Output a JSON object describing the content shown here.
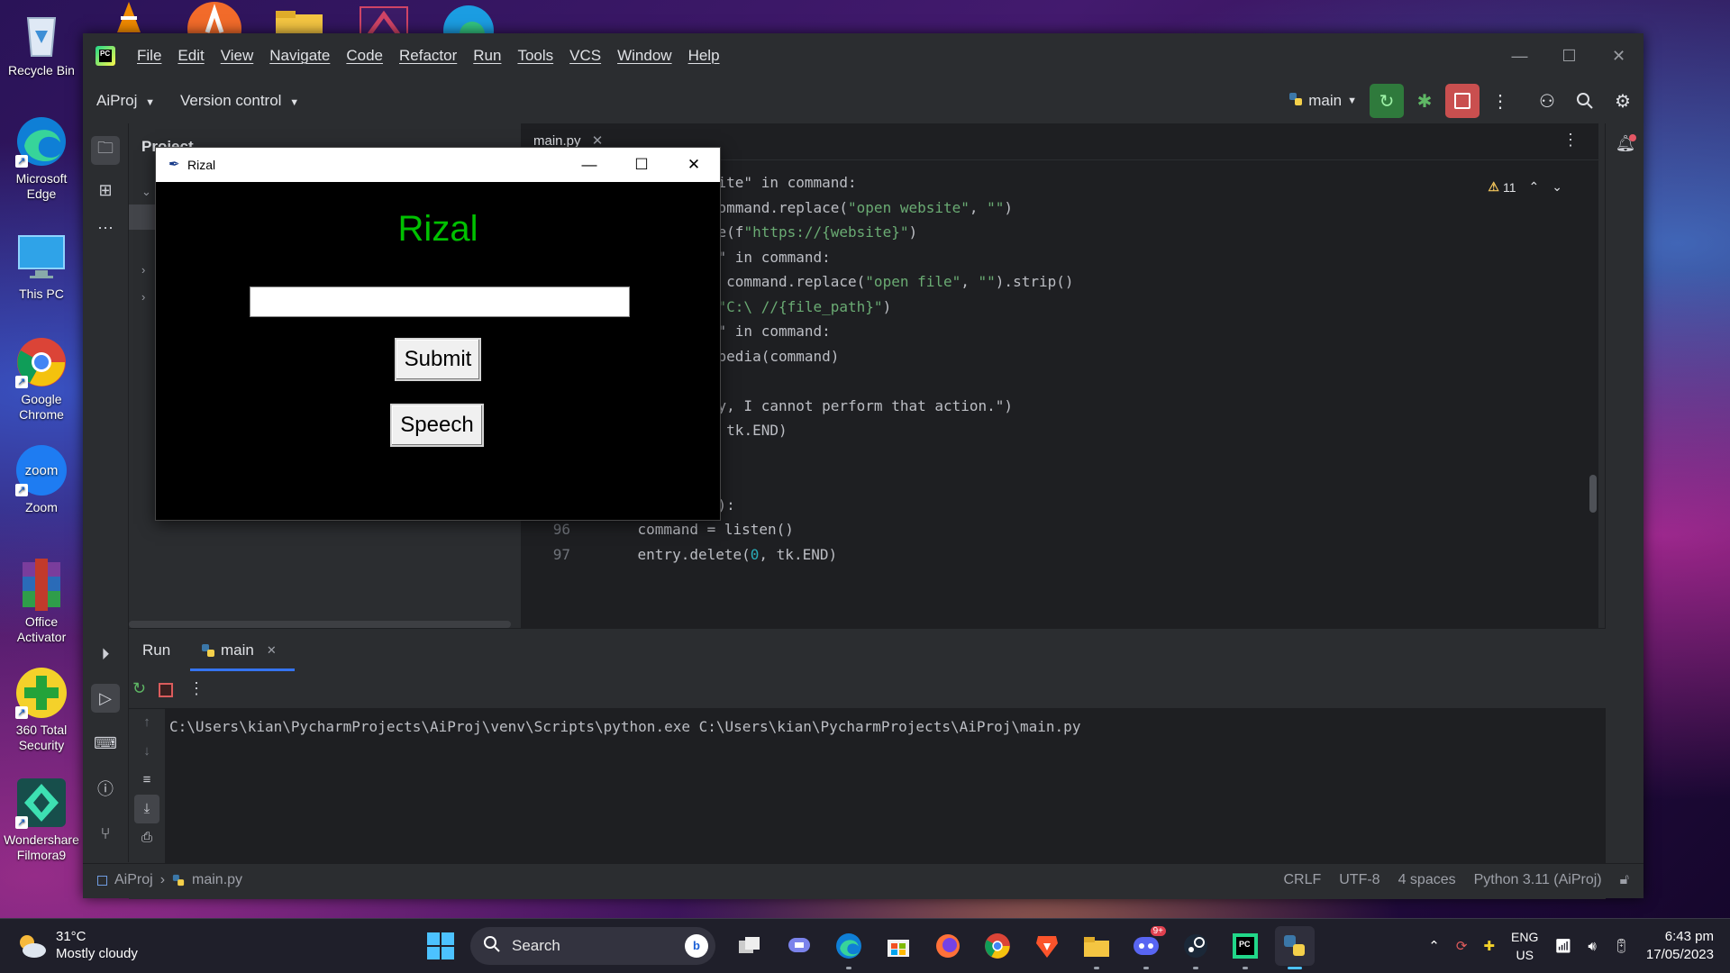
{
  "desktop": {
    "icons": [
      {
        "label": "Recycle Bin",
        "icon": "recycle-bin-icon"
      },
      {
        "label": "Microsoft Edge",
        "icon": "edge-icon"
      },
      {
        "label": "This PC",
        "icon": "monitor-icon"
      },
      {
        "label": "Google Chrome",
        "icon": "chrome-icon"
      },
      {
        "label": "Zoom",
        "icon": "zoom-icon"
      },
      {
        "label": "Office Activator",
        "icon": "winrar-icon"
      },
      {
        "label": "360 Total Security",
        "icon": "security-shield-icon"
      },
      {
        "label": "Wondershare Filmora9",
        "icon": "filmora-icon"
      }
    ]
  },
  "ide": {
    "menu": [
      "File",
      "Edit",
      "View",
      "Navigate",
      "Code",
      "Refactor",
      "Run",
      "Tools",
      "VCS",
      "Window",
      "Help"
    ],
    "project_name": "AiProj",
    "version_control": "Version control",
    "run_config": "main",
    "project_panel_title": "Project",
    "editor_tab": "main.py",
    "warnings_count": "11",
    "code_lines": [
      {
        "n": "",
        "text": "website\" in command:"
      },
      {
        "n": "",
        "text": " = command.replace(\"open website\", \"\")"
      },
      {
        "n": "",
        "text": "bsite(f\"https://{website}\")"
      },
      {
        "n": "",
        "text": "file\" in command:"
      },
      {
        "n": "",
        "text": "th = command.replace(\"open file\", \"\").strip()"
      },
      {
        "n": "",
        "text": "le(f\"C:\\ //{file_path}\")"
      },
      {
        "n": "",
        "text": "edia\" in command:"
      },
      {
        "n": "",
        "text": "wikipedia(command)"
      },
      {
        "n": "",
        "text": ""
      },
      {
        "n": "",
        "text": "Sorry, I cannot perform that action.\")"
      },
      {
        "n": "",
        "text": "e(0, tk.END)"
      },
      {
        "n": "",
        "text": ""
      },
      {
        "n": "",
        "text": ""
      },
      {
        "n": "",
        "text": "ech():"
      },
      {
        "n": "96",
        "text": "    command = listen()"
      },
      {
        "n": "97",
        "text": "    entry.delete(0, tk.END)"
      }
    ],
    "run": {
      "panel_title": "Run",
      "tab_label": "main",
      "command_line": "C:\\Users\\kian\\PycharmProjects\\AiProj\\venv\\Scripts\\python.exe C:\\Users\\kian\\PycharmProjects\\AiProj\\main.py"
    },
    "status": {
      "breadcrumb_project": "AiProj",
      "breadcrumb_file": "main.py",
      "line_sep": "CRLF",
      "encoding": "UTF-8",
      "indent": "4 spaces",
      "interpreter": "Python 3.11 (AiProj)"
    }
  },
  "tk_app": {
    "window_title": "Rizal",
    "heading": "Rizal",
    "heading_color": "#00c100",
    "entry_value": "",
    "submit_label": "Submit",
    "speech_label": "Speech"
  },
  "taskbar": {
    "weather_temp": "31°C",
    "weather_desc": "Mostly cloudy",
    "search_label": "Search",
    "discord_badge": "9+",
    "lang_top": "ENG",
    "lang_bottom": "US",
    "time": "6:43 pm",
    "date": "17/05/2023"
  }
}
